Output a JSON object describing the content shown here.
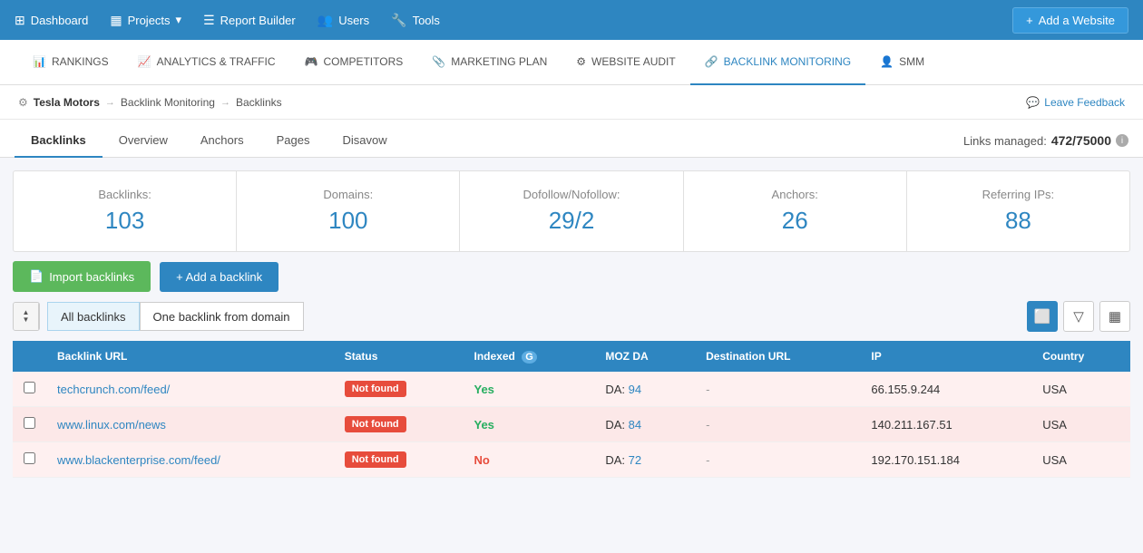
{
  "topNav": {
    "items": [
      {
        "id": "dashboard",
        "label": "Dashboard",
        "icon": "⊞"
      },
      {
        "id": "projects",
        "label": "Projects",
        "icon": "▦",
        "hasDropdown": true
      },
      {
        "id": "report-builder",
        "label": "Report Builder",
        "icon": "☰"
      },
      {
        "id": "users",
        "label": "Users",
        "icon": "👥"
      },
      {
        "id": "tools",
        "label": "Tools",
        "icon": "🔧"
      }
    ],
    "addWebsite": {
      "label": "Add a Website",
      "icon": "+"
    }
  },
  "subNav": {
    "items": [
      {
        "id": "rankings",
        "label": "Rankings",
        "icon": "📊",
        "active": false
      },
      {
        "id": "analytics-traffic",
        "label": "Analytics & Traffic",
        "icon": "📈",
        "active": false
      },
      {
        "id": "competitors",
        "label": "Competitors",
        "icon": "🎮",
        "active": false
      },
      {
        "id": "marketing-plan",
        "label": "Marketing Plan",
        "icon": "📎",
        "active": false
      },
      {
        "id": "website-audit",
        "label": "Website Audit",
        "icon": "⚙",
        "active": false
      },
      {
        "id": "backlink-monitoring",
        "label": "Backlink Monitoring",
        "icon": "🔗",
        "active": true
      },
      {
        "id": "smm",
        "label": "SMM",
        "icon": "👤",
        "active": false
      }
    ]
  },
  "breadcrumb": {
    "gearIcon": "⚙",
    "company": "Tesla Motors",
    "arrow1": "→",
    "section": "Backlink Monitoring",
    "arrow2": "→",
    "current": "Backlinks",
    "feedback": {
      "icon": "💬",
      "label": "Leave Feedback"
    }
  },
  "tabs": {
    "items": [
      {
        "id": "backlinks",
        "label": "Backlinks",
        "active": true
      },
      {
        "id": "overview",
        "label": "Overview",
        "active": false
      },
      {
        "id": "anchors",
        "label": "Anchors",
        "active": false
      },
      {
        "id": "pages",
        "label": "Pages",
        "active": false
      },
      {
        "id": "disavow",
        "label": "Disavow",
        "active": false
      }
    ],
    "linksManaged": {
      "prefix": "Links managed:",
      "value": "472/75000"
    }
  },
  "stats": {
    "backlinks": {
      "label": "Backlinks:",
      "value": "103"
    },
    "domains": {
      "label": "Domains:",
      "value": "100"
    },
    "dofollow": {
      "label": "Dofollow/Nofollow:",
      "value": "29/2"
    },
    "anchors": {
      "label": "Anchors:",
      "value": "26"
    },
    "referringIPs": {
      "label": "Referring IPs:",
      "value": "88"
    }
  },
  "actions": {
    "importLabel": "Import backlinks",
    "addLabel": "+ Add a backlink"
  },
  "filters": {
    "allBacklinks": "All backlinks",
    "oneBacklink": "One backlink from domain"
  },
  "table": {
    "columns": [
      {
        "id": "select",
        "label": ""
      },
      {
        "id": "url",
        "label": "Backlink URL"
      },
      {
        "id": "status",
        "label": "Status"
      },
      {
        "id": "indexed",
        "label": "Indexed"
      },
      {
        "id": "mozda",
        "label": "MOZ DA"
      },
      {
        "id": "destination",
        "label": "Destination URL"
      },
      {
        "id": "ip",
        "label": "IP"
      },
      {
        "id": "country",
        "label": "Country"
      }
    ],
    "rows": [
      {
        "url": "techcrunch.com/feed/",
        "status": "Not found",
        "indexed": "Yes",
        "indexed_class": "yes",
        "da": "94",
        "destination": "-",
        "ip": "66.155.9.244",
        "country": "USA"
      },
      {
        "url": "www.linux.com/news",
        "status": "Not found",
        "indexed": "Yes",
        "indexed_class": "yes",
        "da": "84",
        "destination": "-",
        "ip": "140.211.167.51",
        "country": "USA"
      },
      {
        "url": "www.blackenterprise.com/feed/",
        "status": "Not found",
        "indexed": "No",
        "indexed_class": "no",
        "da": "72",
        "destination": "-",
        "ip": "192.170.151.184",
        "country": "USA"
      }
    ]
  }
}
